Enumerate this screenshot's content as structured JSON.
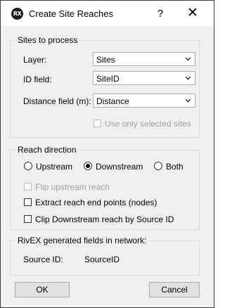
{
  "window": {
    "title": "Create Site Reaches",
    "app_icon_text": "RX",
    "help_label": "?",
    "close_label": "✕"
  },
  "sites": {
    "group_title": "Sites to process",
    "layer_label": "Layer:",
    "layer_value": "Sites",
    "id_label": "ID field:",
    "id_value": "SiteID",
    "distance_label": "Distance field (m):",
    "distance_value": "Distance",
    "selected_only_label": "Use only selected sites",
    "selected_only_checked": false
  },
  "direction": {
    "group_title": "Reach direction",
    "upstream_label": "Upstream",
    "downstream_label": "Downstream",
    "both_label": "Both",
    "selected": "Downstream",
    "flip_label": "Flip upstream reach",
    "extract_label": "Extract reach end points (nodes)",
    "clip_label": "Clip Downstream reach by Source ID"
  },
  "rivex": {
    "group_title": "RivEX generated fields in network:",
    "source_label": "Source ID:",
    "source_value": "SourceID"
  },
  "buttons": {
    "ok_label": "OK",
    "cancel_label": "Cancel"
  }
}
